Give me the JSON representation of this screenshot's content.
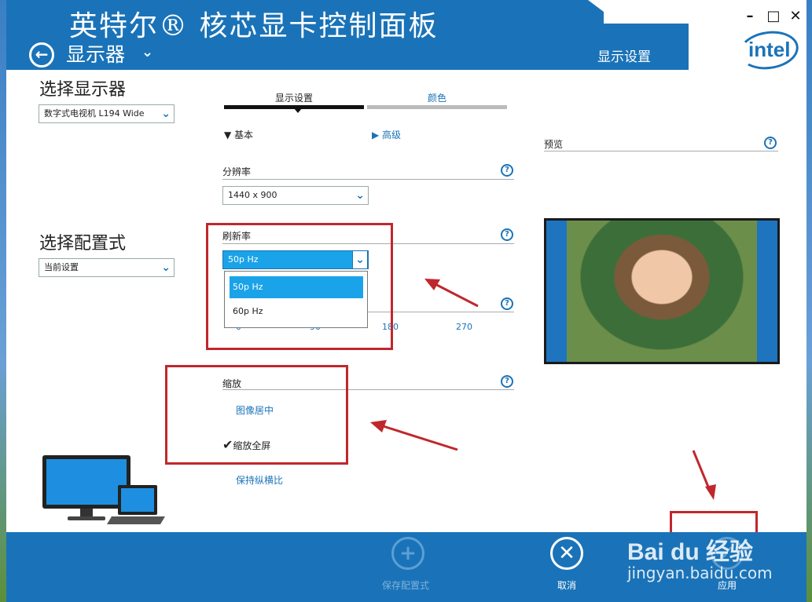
{
  "window": {
    "title": "英特尔® 核芯显卡控制面板",
    "section": "显示器",
    "section_chevron": "chevron-down-icon",
    "header_right_label": "显示设置",
    "brand": "intel",
    "controls": {
      "minimize": "minimize-icon",
      "maximize": "maximize-icon",
      "close": "close-icon"
    }
  },
  "left": {
    "select_display_label": "选择显示器",
    "display_value": "数字式电视机 L194 Wide",
    "select_profile_label": "选择配置式",
    "profile_value": "当前设置"
  },
  "tabs": [
    {
      "label": "显示设置",
      "active": true
    },
    {
      "label": "颜色",
      "active": false
    }
  ],
  "toggles": {
    "basic": "基本",
    "advanced": "高级"
  },
  "resolution": {
    "label": "分辨率",
    "value": "1440 x 900"
  },
  "refresh": {
    "label": "刷新率",
    "value": "50p Hz",
    "options": [
      "50p Hz",
      "60p Hz"
    ],
    "selected_index": 0
  },
  "rotation": {
    "ticks": [
      "0",
      "90",
      "180",
      "270"
    ]
  },
  "scaling": {
    "label": "缩放",
    "options": [
      {
        "label": "图像居中",
        "checked": false
      },
      {
        "label": "缩放全屏",
        "checked": true
      },
      {
        "label": "保持纵横比",
        "checked": false
      }
    ]
  },
  "preview": {
    "label": "预览"
  },
  "bottom": {
    "save_profile": "保存配置式",
    "cancel": "取消",
    "apply": "应用"
  },
  "watermark": {
    "logo": "Bai du 经验",
    "url": "jingyan.baidu.com"
  },
  "colors": {
    "accent": "#1a73b8",
    "annotation_red": "#c0272d",
    "selected_option": "#1aa3e8"
  }
}
